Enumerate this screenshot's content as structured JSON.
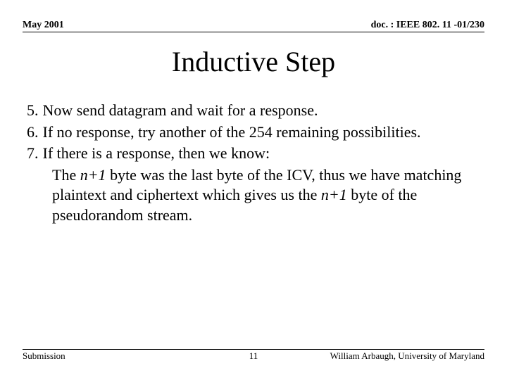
{
  "header": {
    "date": "May 2001",
    "doc": "doc. : IEEE 802. 11 -01/230"
  },
  "title": "Inductive Step",
  "items": [
    {
      "num": "5.",
      "text": "Now send datagram and wait for a response."
    },
    {
      "num": "6.",
      "text": "If no response, try another of the 254 remaining possibilities."
    },
    {
      "num": "7.",
      "text": "If there is a response, then we know:"
    }
  ],
  "sub": {
    "pre1": "The ",
    "it1": "n+1",
    "mid": " byte was the last byte of the ICV, thus we have matching plaintext and ciphertext which gives us the ",
    "it2": "n+1",
    "post": " byte of the pseudorandom stream."
  },
  "footer": {
    "left": "Submission",
    "page": "11",
    "right": "William Arbaugh, University of Maryland"
  }
}
